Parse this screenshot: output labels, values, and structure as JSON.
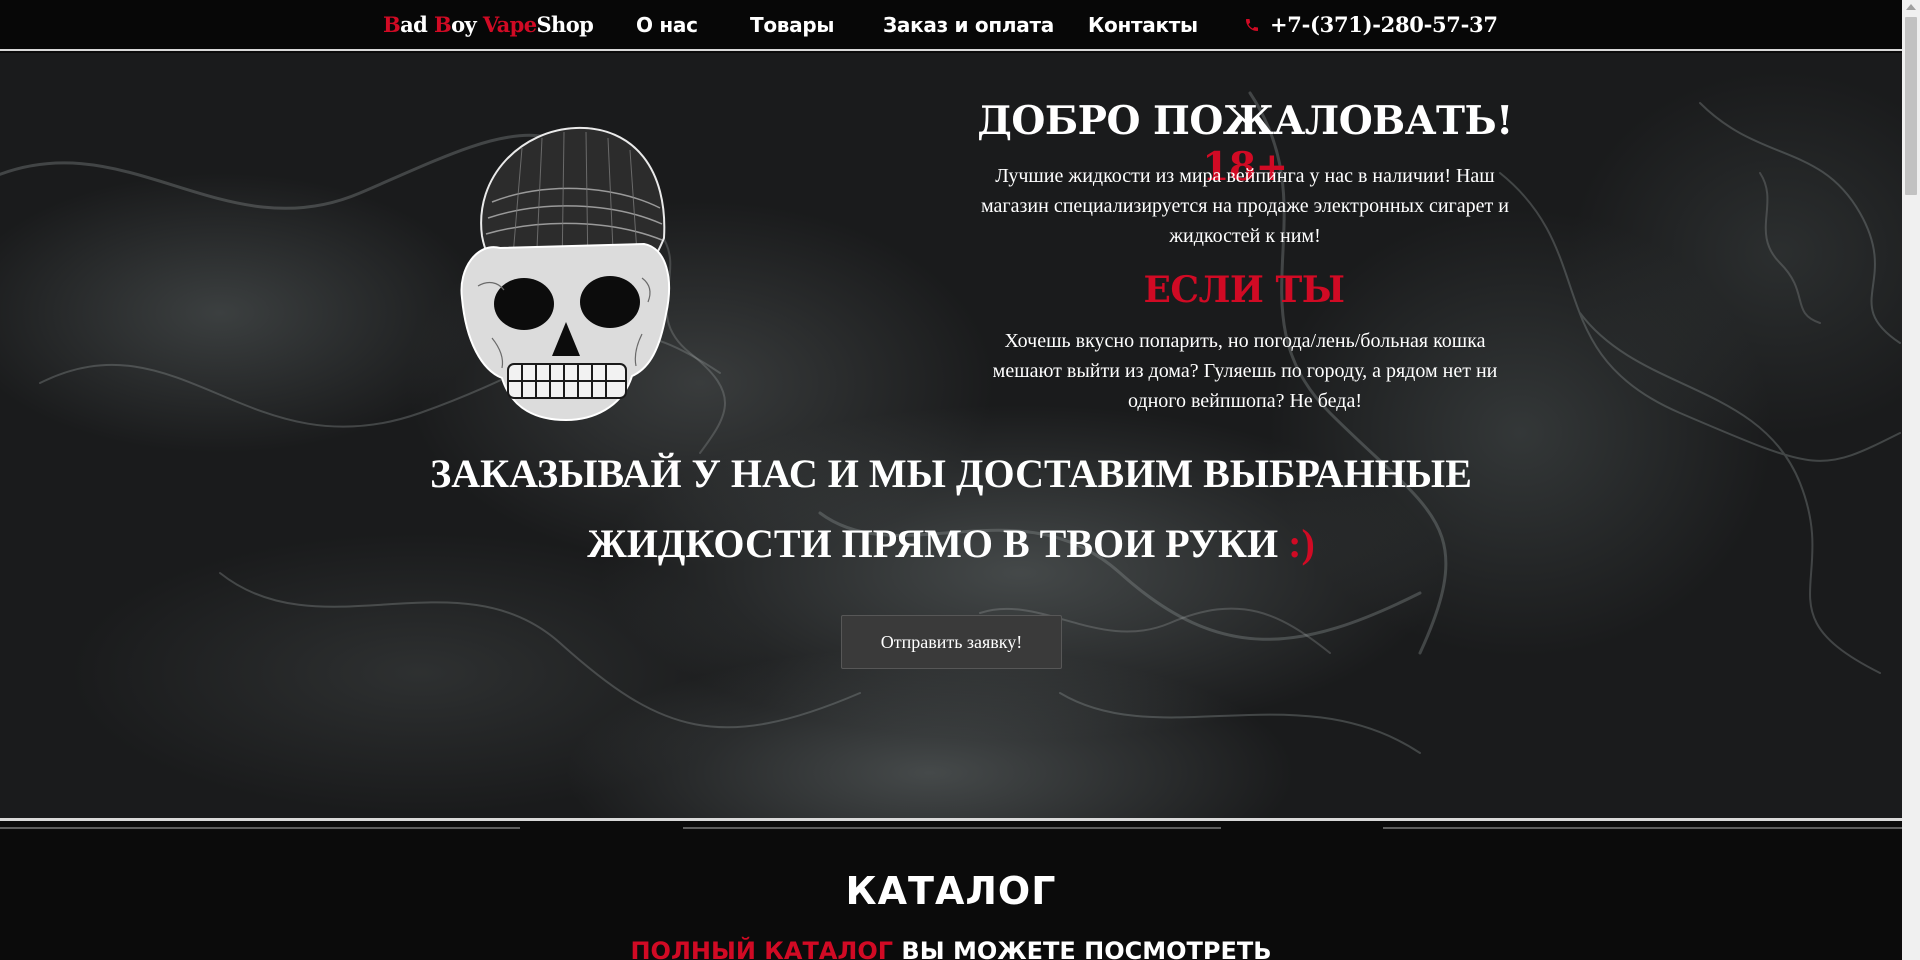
{
  "nav": {
    "logo": {
      "p1": "B",
      "p2": "ad ",
      "p3": "B",
      "p4": "oy ",
      "p5": "Vape",
      "p6": "Shop"
    },
    "items": [
      {
        "label": "О нас"
      },
      {
        "label": "Товары"
      },
      {
        "label": "Заказ и оплата"
      },
      {
        "label": "Контакты"
      }
    ],
    "phone": "+7-(371)-280-57-37",
    "phone_icon": "phone-icon"
  },
  "hero": {
    "welcome": "ДОБРО ПОЖАЛОВАТЬ!",
    "age_badge": "18+",
    "intro": "Лучшие жидкости из мира вейпинга у нас в наличии! Наш магазин специализируется на продаже электронных сигарет и жидкостей к ним!",
    "if_you": "ЕСЛИ ТЫ",
    "if_text": "Хочешь вкусно попарить, но погода/лень/больная кошка мешают выйти из дома? Гуляешь по городу, а рядом нет ни одного вейпшопа? Не беда!",
    "cta_line1": "ЗАКАЗЫВАЙ У НАС И МЫ ДОСТАВИМ ВЫБРАННЫЕ",
    "cta_line2": "ЖИДКОСТИ ПРЯМО В ТВОИ РУКИ",
    "cta_smile": ":)",
    "submit": "Отправить заявку!"
  },
  "catalog": {
    "title": "КАТАЛОГ",
    "sub_red": "ПОЛНЫЙ КАТАЛОГ",
    "sub_rest": "ВЫ МОЖЕТЕ ПОСМОТРЕТЬ"
  },
  "colors": {
    "accent_red": "#d10a24",
    "background": "#0b0b0b",
    "button": "#3a3a3a"
  }
}
